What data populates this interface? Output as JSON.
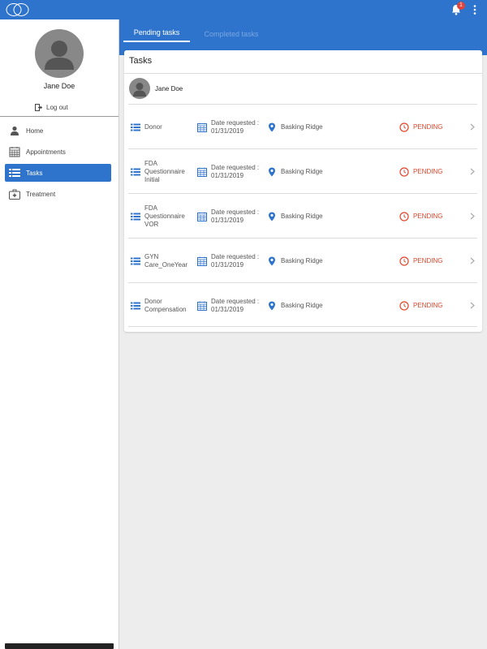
{
  "app": {
    "brand_color": "#2f74cc",
    "notification_count": "1"
  },
  "tabs": [
    {
      "label": "Pending tasks",
      "active": true
    },
    {
      "label": "Completed tasks",
      "active": false
    }
  ],
  "sidebar": {
    "user_name": "Jane Doe",
    "logout_label": "Log out",
    "items": [
      {
        "label": "Home",
        "icon": "person-icon",
        "active": false
      },
      {
        "label": "Appointments",
        "icon": "calendar-icon",
        "active": false
      },
      {
        "label": "Tasks",
        "icon": "list-icon",
        "active": true
      },
      {
        "label": "Treatment",
        "icon": "medical-kit-icon",
        "active": false
      }
    ]
  },
  "card": {
    "title": "Tasks",
    "patient_name": "Jane Doe",
    "date_prefix": "Date requested :",
    "tasks": [
      {
        "name": "Donor",
        "date": "01/31/2019",
        "location": "Basking Ridge",
        "status": "PENDING"
      },
      {
        "name": "FDA Questionnaire Initial",
        "date": "01/31/2019",
        "location": "Basking Ridge",
        "status": "PENDING"
      },
      {
        "name": "FDA Questionnaire VOR",
        "date": "01/31/2019",
        "location": "Basking Ridge",
        "status": "PENDING"
      },
      {
        "name": "GYN Care_OneYear",
        "date": "01/31/2019",
        "location": "Basking Ridge",
        "status": "PENDING"
      },
      {
        "name": "Donor Compensation",
        "date": "01/31/2019",
        "location": "Basking Ridge",
        "status": "PENDING"
      }
    ]
  },
  "colors": {
    "pending": "#e2452a",
    "accent": "#2f74cc"
  }
}
